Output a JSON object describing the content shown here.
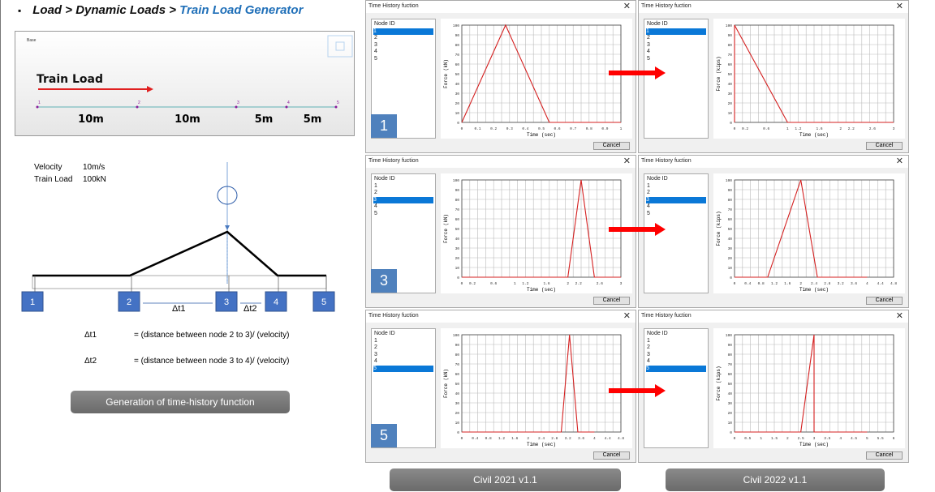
{
  "title": {
    "bullet": "▪",
    "path": "Load > Dynamic Loads  > ",
    "current": "Train Load Generator"
  },
  "model_view": {
    "toolbar_label": "Base",
    "train_label": "Train Load",
    "spans": [
      "10m",
      "10m",
      "5m",
      "5m"
    ],
    "node_labels": [
      "1",
      "2",
      "3",
      "4",
      "5"
    ]
  },
  "diagram": {
    "velocity_label": "Velocity",
    "velocity_value": "10m/s",
    "load_label": "Train Load",
    "load_value": "100kN",
    "nodes": [
      "1",
      "2",
      "3",
      "4",
      "5"
    ],
    "dt1": "Δt1",
    "dt2": "Δt2",
    "eq1_label": "Δt1",
    "eq1_text": "= (distance between node 2 to 3)/ (velocity)",
    "eq2_label": "Δt2",
    "eq2_text": "= (distance between node 3 to 4)/ (velocity)",
    "button": "Generation of time-history function"
  },
  "versions": [
    "Civil 2021 v1.1",
    "Civil 2022 v1.1"
  ],
  "colors": {
    "line": "#d42020",
    "select": "#0a78d7",
    "badge": "#4f81bd",
    "arrow": "#ff0000"
  },
  "dialog_common": {
    "title": "Time History fuction",
    "list_header": "Node ID",
    "nodes": [
      "1",
      "2",
      "3",
      "4",
      "5"
    ],
    "cancel": "Cancel",
    "close_icon": "✕"
  },
  "chart_data": [
    {
      "type": "line",
      "version": "Civil 2021 v1.1",
      "selected_node": "1",
      "badge": "1",
      "xlabel": "Time (sec)",
      "ylabel": "Force (kN)",
      "xlim": [
        0,
        1
      ],
      "ylim": [
        0,
        100
      ],
      "xticks": [
        0,
        0.1,
        0.2,
        0.3,
        0.4,
        0.5,
        0.6,
        0.7,
        0.8,
        0.9,
        1
      ],
      "x": [
        0,
        0.275,
        0.55,
        1
      ],
      "y": [
        0,
        100,
        0,
        0
      ],
      "grid": true
    },
    {
      "type": "line",
      "version": "Civil 2022 v1.1",
      "selected_node": "1",
      "badge": "",
      "xlabel": "Time (sec)",
      "ylabel": "Force (kips)",
      "xlim": [
        0,
        3
      ],
      "ylim": [
        0,
        100
      ],
      "xticks": [
        0,
        0.2,
        0.6,
        1,
        1.2,
        1.6,
        2,
        2.2,
        2.6,
        3
      ],
      "x": [
        0,
        0,
        1,
        3
      ],
      "y": [
        0,
        100,
        0,
        0
      ],
      "grid": true
    },
    {
      "type": "line",
      "version": "Civil 2021 v1.1",
      "selected_node": "3",
      "badge": "3",
      "xlabel": "Time (sec)",
      "ylabel": "Force (kN)",
      "xlim": [
        0,
        3
      ],
      "ylim": [
        0,
        100
      ],
      "xticks": [
        0,
        0.2,
        0.6,
        1,
        1.2,
        1.6,
        2,
        2.2,
        2.6,
        3
      ],
      "x": [
        0,
        2,
        2.25,
        2.5,
        3
      ],
      "y": [
        0,
        0,
        100,
        0,
        0
      ],
      "grid": true
    },
    {
      "type": "line",
      "version": "Civil 2022 v1.1",
      "selected_node": "3",
      "badge": "",
      "xlabel": "Time (sec)",
      "ylabel": "Force (kips)",
      "xlim": [
        0,
        4.8
      ],
      "ylim": [
        0,
        100
      ],
      "xticks": [
        0,
        0.4,
        0.8,
        1.2,
        1.6,
        2,
        2.4,
        2.8,
        3.2,
        3.6,
        4,
        4.4,
        4.8
      ],
      "x": [
        0,
        1,
        2,
        2.5,
        4
      ],
      "y": [
        0,
        0,
        100,
        0,
        0
      ],
      "grid": true
    },
    {
      "type": "line",
      "version": "Civil 2021 v1.1",
      "selected_node": "5",
      "badge": "5",
      "xlabel": "Time (sec)",
      "ylabel": "Force (kN)",
      "xlim": [
        0,
        4.8
      ],
      "ylim": [
        0,
        100
      ],
      "xticks": [
        0,
        0.4,
        0.8,
        1.2,
        1.6,
        2,
        2.4,
        2.8,
        3.2,
        3.6,
        4,
        4.4,
        4.8
      ],
      "x": [
        0,
        3,
        3.25,
        3.5,
        4
      ],
      "y": [
        0,
        0,
        100,
        0,
        0
      ],
      "grid": true
    },
    {
      "type": "line",
      "version": "Civil 2022 v1.1",
      "selected_node": "5",
      "badge": "",
      "xlabel": "Time (sec)",
      "ylabel": "Force (kips)",
      "xlim": [
        0,
        6
      ],
      "ylim": [
        0,
        100
      ],
      "xticks": [
        0,
        0.5,
        1,
        1.5,
        2,
        2.5,
        3,
        3.5,
        4,
        4.5,
        5,
        5.5,
        6
      ],
      "x": [
        0,
        2.5,
        3,
        3,
        5
      ],
      "y": [
        0,
        0,
        100,
        0,
        0
      ],
      "grid": true
    }
  ]
}
